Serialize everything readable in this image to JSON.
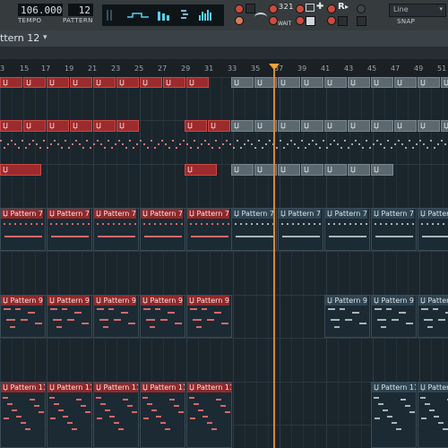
{
  "toolbar": {
    "tempo_value": "106.000",
    "tempo_label": "TEMPO",
    "pattern_value": "12",
    "pattern_label": "PATTERN",
    "snap_value": "Line",
    "snap_label": "SNAP",
    "wait_label": "WAIT",
    "countdown_label": "3 2 1",
    "record_label": "R"
  },
  "playlist": {
    "pattern_selector": "ttern 12",
    "ruler_numbers": [
      "3",
      "15",
      "17",
      "19",
      "21",
      "23",
      "25",
      "27",
      "29",
      "31",
      "33",
      "35",
      "37",
      "39",
      "41",
      "43",
      "45",
      "47",
      "49",
      "51"
    ],
    "clip_label_prefix": "Pattern",
    "lanes": [
      {
        "name": "lane-1",
        "clip_color": "red"
      },
      {
        "name": "lane-2",
        "clip_color": "red"
      },
      {
        "name": "lane-3",
        "clip_color": "red"
      },
      {
        "name": "lane-pattern-7",
        "clip_label": "Pattern 7"
      },
      {
        "name": "lane-pattern-9",
        "clip_label": "Pattern 9"
      },
      {
        "name": "lane-pattern-11",
        "clip_label": "Pattern 11"
      }
    ]
  },
  "colors": {
    "red_clip": "#9c2b2d",
    "grey_clip": "#5b6870",
    "playhead": "#d9853a",
    "background": "#1b252c"
  }
}
